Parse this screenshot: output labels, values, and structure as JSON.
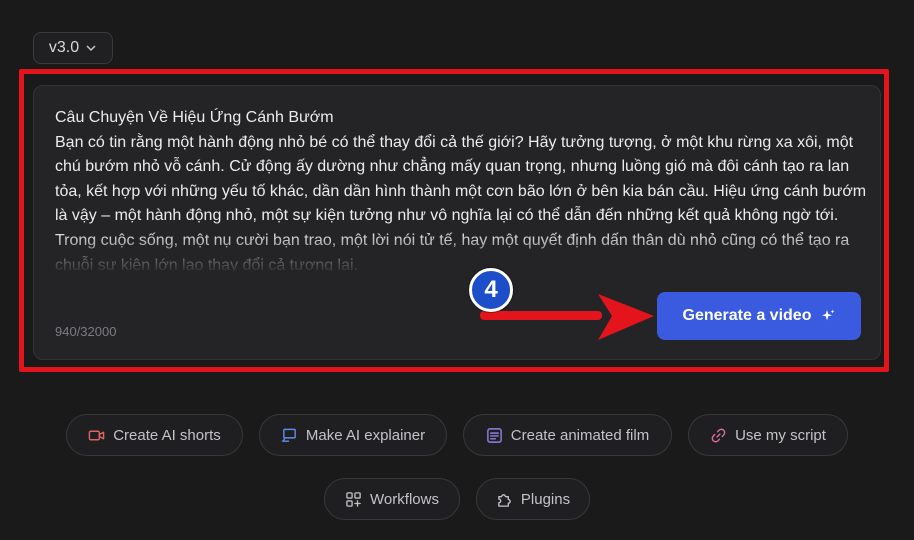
{
  "version_selector": {
    "label": "v3.0",
    "icon": "chevron-down-icon"
  },
  "editor": {
    "title": "Câu Chuyện Về Hiệu Ứng Cánh Bướm",
    "body": "Bạn có tin rằng một hành động nhỏ bé có thể thay đổi cả thế giới? Hãy tưởng tượng, ở một khu rừng xa xôi, một chú bướm nhỏ vỗ cánh. Cử động ấy dường như chẳng mấy quan trọng, nhưng luồng gió mà đôi cánh tạo ra lan tỏa, kết hợp với những yếu tố khác, dần dần hình thành một cơn bão lớn ở bên kia bán cầu. Hiệu ứng cánh bướm là vậy – một hành động nhỏ, một sự kiện tưởng như vô nghĩa lại có thể dẫn đến những kết quả không ngờ tới. Trong cuộc sống, một nụ cười bạn trao, một lời nói tử tế, hay một quyết định dấn thân dù nhỏ cũng có thể tạo ra chuỗi sự kiện lớn lao thay đổi cả tương lai.",
    "char_count": "940/32000",
    "generate_label": "Generate a video",
    "generate_icon": "sparkle-icon"
  },
  "annotation": {
    "step_number": "4",
    "frame_color": "#e3141b",
    "arrow_color": "#e3141b"
  },
  "actions": [
    {
      "label": "Create AI shorts",
      "icon": "video-camera-icon",
      "icon_color": "#e0655f"
    },
    {
      "label": "Make AI explainer",
      "icon": "presentation-icon",
      "icon_color": "#5b8de8"
    },
    {
      "label": "Create animated film",
      "icon": "list-document-icon",
      "icon_color": "#8f82e6"
    },
    {
      "label": "Use my script",
      "icon": "link-icon",
      "icon_color": "#d96ba0"
    },
    {
      "label": "Workflows",
      "icon": "grid-plus-icon",
      "icon_color": "#c3c3c8"
    },
    {
      "label": "Plugins",
      "icon": "puzzle-icon",
      "icon_color": "#c3c3c8"
    }
  ],
  "colors": {
    "background": "#1a1a1b",
    "panel": "#242426",
    "accent": "#3a5be0"
  }
}
